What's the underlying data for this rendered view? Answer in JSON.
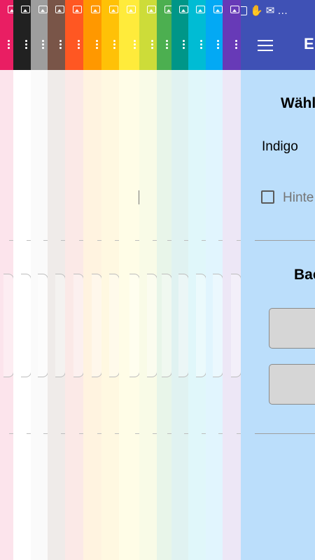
{
  "strips": [
    {
      "name": "pink",
      "bar": "#e91e63",
      "body": "#fce4ec"
    },
    {
      "name": "black",
      "bar": "#212121",
      "body": "#ffffff"
    },
    {
      "name": "grey",
      "bar": "#9e9e9e",
      "body": "#fafafa"
    },
    {
      "name": "brown",
      "bar": "#795548",
      "body": "#efebe9"
    },
    {
      "name": "deep-orange",
      "bar": "#ff5722",
      "body": "#fbe9e7"
    },
    {
      "name": "orange",
      "bar": "#ff9800",
      "body": "#fff3e0"
    },
    {
      "name": "amber",
      "bar": "#ffc107",
      "body": "#fff8e1"
    },
    {
      "name": "yellow",
      "bar": "#ffeb3b",
      "body": "#fffde7"
    },
    {
      "name": "lime",
      "bar": "#cddc39",
      "body": "#f9fbe7"
    },
    {
      "name": "green",
      "bar": "#4caf50",
      "body": "#e8f5e9"
    },
    {
      "name": "teal",
      "bar": "#009688",
      "body": "#e0f2f1"
    },
    {
      "name": "cyan",
      "bar": "#00bcd4",
      "body": "#e0f7fa"
    },
    {
      "name": "light-blue",
      "bar": "#03a9f4",
      "body": "#e1f5fe"
    },
    {
      "name": "deep-purple",
      "bar": "#673ab7",
      "body": "#ede7f6"
    }
  ],
  "front": {
    "appbar_color": "#3f51b5",
    "body_color": "#bbdefb",
    "title": "Ei",
    "section1_title": "Wähl",
    "color_value": "Indigo",
    "checkbox_label": "Hinte",
    "section2_title": "Bac",
    "status_icons": [
      "image-icon",
      "hand-icon",
      "mail-icon",
      "more-icon"
    ],
    "status_more": "…"
  }
}
